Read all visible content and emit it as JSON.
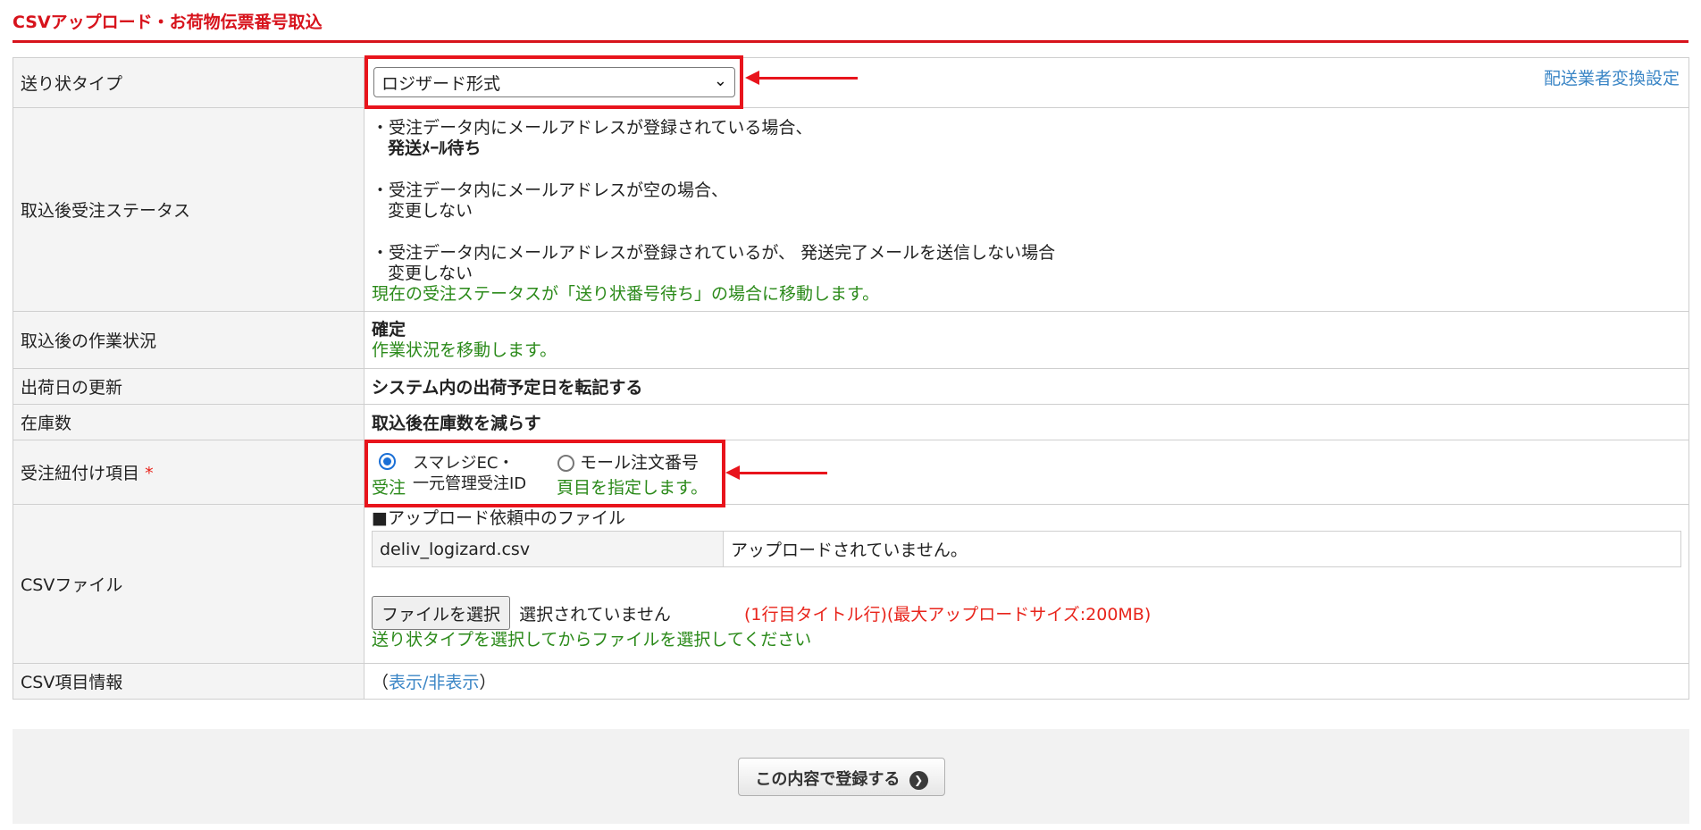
{
  "page_title": "CSVアップロード・お荷物伝票番号取込",
  "rows": {
    "invoice_type": {
      "label": "送り状タイプ",
      "selected": "ロジザード形式",
      "link": "配送業者変換設定"
    },
    "status": {
      "label": "取込後受注ステータス",
      "lines": [
        "・受注データ内にメールアドレスが登録されている場合、",
        "発送ﾒｰﾙ待ち",
        "・受注データ内にメールアドレスが空の場合、",
        "変更しない",
        "・受注データ内にメールアドレスが登録されているが、 発送完了メールを送信しない場合",
        "変更しない"
      ],
      "note": "現在の受注ステータスが「送り状番号待ち」の場合に移動します。"
    },
    "work_status": {
      "label": "取込後の作業状況",
      "value": "確定",
      "note": "作業状況を移動します。"
    },
    "ship_date": {
      "label": "出荷日の更新",
      "value": "システム内の出荷予定日を転記する"
    },
    "stock": {
      "label": "在庫数",
      "value": "取込後在庫数を減らす"
    },
    "link_item": {
      "label": "受注紐付け項目",
      "required_mark": "*",
      "option1_line1": "スマレジEC・",
      "option1_line2": "一元管理受注ID",
      "option2": "モール注文番号",
      "note_left": "受注",
      "note_right": "頁目を指定します。"
    },
    "csv_file": {
      "label": "CSVファイル",
      "pending_heading": "■アップロード依頼中のファイル",
      "file_name": "deliv_logizard.csv",
      "file_status": "アップロードされていません。",
      "choose_button": "ファイルを選択",
      "no_file": "選択されていません",
      "hint_red": "(1行目タイトル行)(最大アップロードサイズ:200MB)",
      "hint_green": "送り状タイプを選択してからファイルを選択してください"
    },
    "csv_info": {
      "label": "CSV項目情報",
      "paren_open": "（",
      "toggle_link": "表示/非表示",
      "paren_close": "）"
    }
  },
  "submit_label": "この内容で登録する",
  "colors": {
    "accent_red": "#d7131c",
    "annotation_red": "#e8141c",
    "note_green": "#2b8a1a",
    "link_blue": "#3b86c6"
  }
}
